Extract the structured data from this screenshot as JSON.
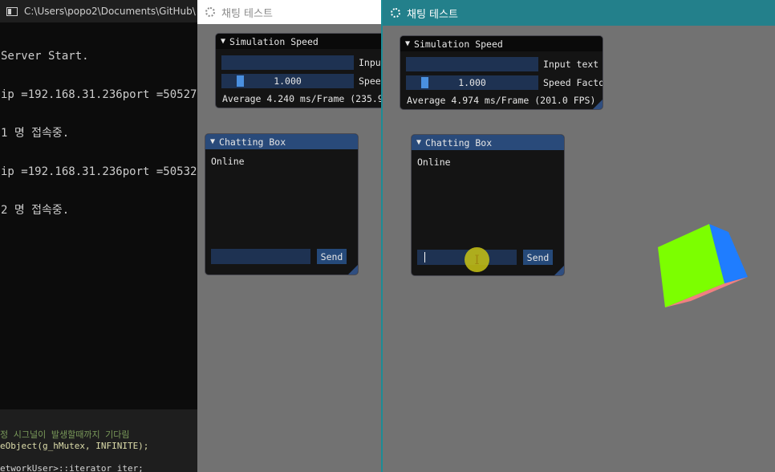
{
  "console": {
    "title": "C:\\Users\\popo2\\Documents\\GitHub\\",
    "lines": [
      "Server Start.",
      "ip =192.168.31.236port =50527",
      "1 명 접속중.",
      "ip =192.168.31.236port =50532",
      "2 명 접속중."
    ]
  },
  "editor": {
    "lines": [
      "정 시그널이 발생할때까지 기다림",
      "eObject(g_hMutex, INFINITE);",
      "",
      "etworkUser>::iterator iter;"
    ]
  },
  "back_window": {
    "title": "채팅 테스트",
    "sim": {
      "title": "Simulation Speed",
      "input_label": "Input",
      "slider_value": "1.000",
      "slider_fraction": 0.12,
      "speed_label": "Speed",
      "average": "Average 4.240 ms/Frame (235.9"
    },
    "chat": {
      "title": "Chatting Box",
      "status": "Online",
      "send_label": "Send",
      "input_value": ""
    }
  },
  "front_window": {
    "title": "채팅 테스트",
    "sim": {
      "title": "Simulation Speed",
      "input_label": "Input text",
      "slider_value": "1.000",
      "slider_fraction": 0.12,
      "speed_label": "Speed Facto",
      "average": "Average 4.974 ms/Frame (201.0 FPS)"
    },
    "chat": {
      "title": "Chatting Box",
      "status": "Online",
      "send_label": "Send",
      "input_value": ""
    }
  },
  "colors": {
    "accent": "#23808b",
    "imgui_blue": "#294a7a",
    "cube_front": "#7cff00",
    "cube_side": "#1f7dff",
    "cube_bottom": "#f08080"
  },
  "icons": [
    "console-icon",
    "gear-icon",
    "collapse-arrow-icon",
    "text-cursor-icon",
    "cube-3d"
  ]
}
